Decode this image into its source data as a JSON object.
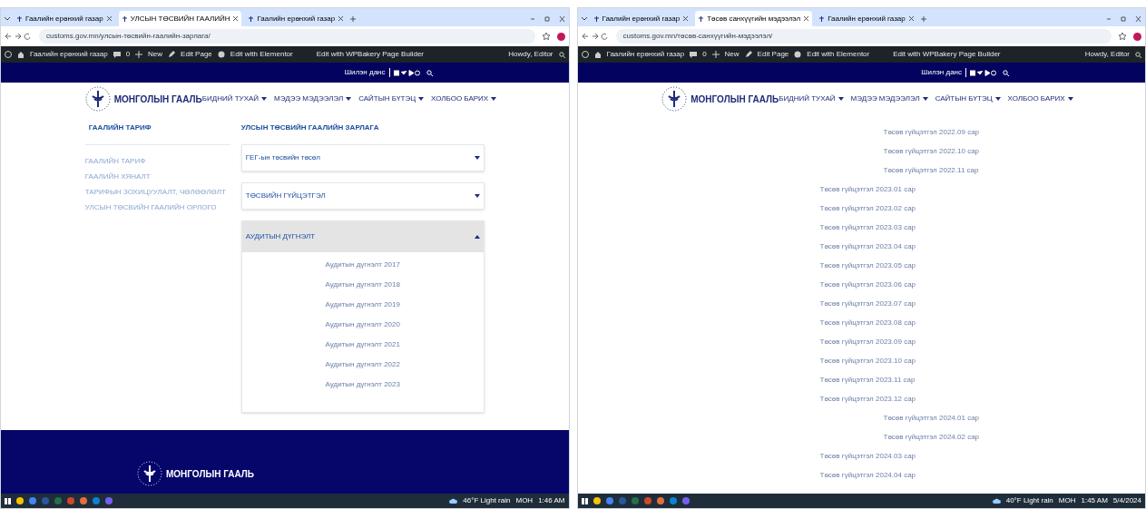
{
  "windows": [
    {
      "kind": "accordion-page",
      "tabs": [
        {
          "label": "Гаалийн ерөнхий газар",
          "selected": false
        },
        {
          "label": "УЛСЫН ТӨСВИЙН ГААЛИЙН",
          "selected": true
        },
        {
          "label": "Гаалийн ерөнхий газар",
          "selected": false
        }
      ],
      "url": "customs.gov.mn/улсын-төсвийн-гаалийн-зарлага/",
      "admin_bar": {
        "site": "Гаалийн ерөнхий газар",
        "comments": "0",
        "new": "New",
        "edit": "Edit Page",
        "elementor": "Edit with Elementor",
        "wpbakery": "Edit with WPBakery Page Builder",
        "howdy": "Howdy, Editor"
      },
      "top_bar": {
        "label": "Шилэн данс"
      },
      "logo": "МОНГОЛЫН ГААЛЬ",
      "nav": [
        "БИДНИЙ ТУХАЙ",
        "МЭДЭЭ МЭДЭЭЛЭЛ",
        "САЙТЫН БҮТЭЦ",
        "ХОЛБОО БАРИХ"
      ],
      "sidebar": {
        "title": "ГААЛИЙН ТАРИФ",
        "items": [
          "ГААЛИЙН ТАРИФ",
          "ГААЛИЙН ХЯНАЛТ",
          "ТАРИФЫН ЗОХИЦУУЛАЛТ, ЧӨЛӨӨЛӨЛТ",
          "УЛСЫН ТӨСВИЙН ГААЛИЙН ОРЛОГО"
        ]
      },
      "heading": "УЛСЫН ТӨСВИЙН ГААЛИЙН ЗАРЛАГА",
      "accordion": [
        {
          "title": "ГЕГ-ын төсвийн төсөл",
          "expanded": false
        },
        {
          "title": "ТӨСВИЙН ГҮЙЦЭТГЭЛ",
          "expanded": false
        },
        {
          "title": "АУДИТЫН ДҮГНЭЛТ",
          "expanded": true,
          "items": [
            "Аудитын дүгнэлт 2017",
            "Аудитын дүгнэлт 2018",
            "Аудитын дүгнэлт 2019",
            "Аудитын дүгнэлт 2020",
            "Аудитын дүгнэлт 2021",
            "Аудитын дүгнэлт 2022",
            "Аудитын дүгнэлт 2023"
          ]
        }
      ],
      "footer_logo": "МОНГОЛЫН ГААЛЬ",
      "taskbar": {
        "weather": "46°F Light rain",
        "lang": "МОН",
        "time": "1:46 AM"
      }
    },
    {
      "kind": "list-page",
      "tabs": [
        {
          "label": "Гаалийн ерөнхий газар",
          "selected": false
        },
        {
          "label": "Төсөв санхүүгийн мэдээлэл",
          "selected": true
        },
        {
          "label": "Гаалийн ерөнхий газар",
          "selected": false
        }
      ],
      "url": "customs.gov.mn/төсөв-санхүүгийн-мэдээлэл/",
      "admin_bar": {
        "site": "Гаалийн ерөнхий газар",
        "comments": "0",
        "new": "New",
        "edit": "Edit Page",
        "elementor": "Edit with Elementor",
        "wpbakery": "Edit with WPBakery Page Builder",
        "howdy": "Howdy, Editor"
      },
      "top_bar": {
        "label": "Шилэн данс"
      },
      "logo": "МОНГОЛЫН ГААЛЬ",
      "nav": [
        "БИДНИЙ ТУХАЙ",
        "МЭДЭЭ МЭДЭЭЛЭЛ",
        "САЙТЫН БҮТЭЦ",
        "ХОЛБОО БАРИХ"
      ],
      "links": [
        {
          "text": "Төсөв гүйцэтгэл 2022.09 сар",
          "kind": "centered"
        },
        {
          "text": "Төсөв гүйцэтгэл 2022.10 сар",
          "kind": "centered"
        },
        {
          "text": "Төсөв гүйцэтгэл 2022.11 сар",
          "kind": "centered"
        },
        {
          "text": "Төсөв гүйцэтгэл 2023.01 сар",
          "kind": "left"
        },
        {
          "text": "Төсөв гүйцэтгэл 2023.02 сар",
          "kind": "left"
        },
        {
          "text": "Төсөв гүйцэтгэл 2023.03 сар",
          "kind": "left"
        },
        {
          "text": "Төсөв гүйцэтгэл 2023.04 сар",
          "kind": "left"
        },
        {
          "text": "Төсөв гүйцэтгэл 2023.05 сар",
          "kind": "left"
        },
        {
          "text": "Төсөв гүйцэтгэл 2023.06 сар",
          "kind": "left"
        },
        {
          "text": "Төсөв гүйцэтгэл 2023.07 сар",
          "kind": "left"
        },
        {
          "text": "Төсөв гүйцэтгэл 2023.08 сар",
          "kind": "left"
        },
        {
          "text": "Төсөв гүйцэтгэл 2023.09 сар",
          "kind": "left"
        },
        {
          "text": "Төсөв гүйцэтгэл 2023.10 сар",
          "kind": "left"
        },
        {
          "text": "Төсөв гүйцэтгэл 2023.11 сар",
          "kind": "left"
        },
        {
          "text": "Төсөв гүйцэтгэл 2023.12 сар",
          "kind": "left"
        },
        {
          "text": "Төсөв гүйцэтгэл 2024.01 сар",
          "kind": "centered"
        },
        {
          "text": "Төсөв гүйцэтгэл 2024.02 сар",
          "kind": "centered"
        },
        {
          "text": "Төсөв гүйцэтгэл 2024.03 сар",
          "kind": "left"
        },
        {
          "text": "Төсөв гүйцэтгэл 2024.04 сар",
          "kind": "left"
        }
      ],
      "taskbar": {
        "weather": "40°F Light rain",
        "lang": "МОН",
        "time": "1:45 AM",
        "date": "5/4/2024"
      }
    }
  ]
}
